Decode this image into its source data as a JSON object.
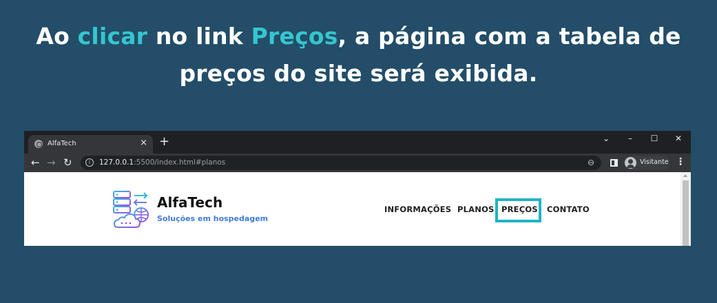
{
  "headline": {
    "line1_part1": "Ao ",
    "line1_highlight1": "clicar",
    "line1_part2": " no link ",
    "line1_highlight2": "Preços",
    "line1_part3": ", a página com a tabela de",
    "line2": "preços do site será exibida."
  },
  "colors": {
    "background": "#234d68",
    "highlight_text": "#35c6cf",
    "highlight_box": "#1fb4c4",
    "tagline": "#3f7bd6"
  },
  "browser": {
    "tab_title": "AlfaTech",
    "tab_close": "×",
    "new_tab": "+",
    "window_controls": {
      "dropdown": "⌄",
      "minimize": "–",
      "maximize": "☐",
      "close": "✕"
    },
    "nav": {
      "back": "←",
      "forward": "→",
      "reload": "↻"
    },
    "url_host": "127.0.0.1",
    "url_rest": ":5500/index.html#planos",
    "info_icon": "i",
    "zoom_icon": "⊖",
    "profile_name": "Visitante",
    "menu": "⋮"
  },
  "site": {
    "brand_name": "AlfaTech",
    "tagline": "Soluções em hospedagem",
    "nav_items": [
      "INFORMAÇÕES",
      "PLANOS",
      "PREÇOS",
      "CONTATO"
    ],
    "highlighted_nav_item": "PREÇOS"
  }
}
